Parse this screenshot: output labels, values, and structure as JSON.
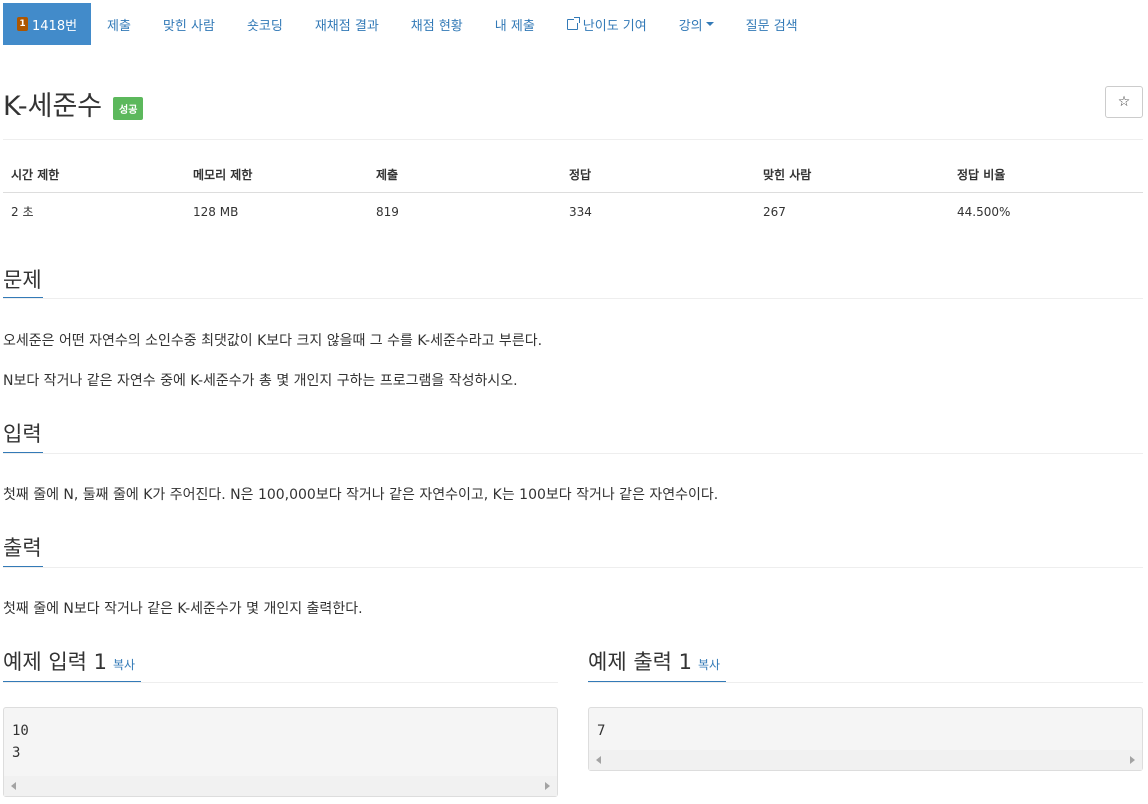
{
  "nav": {
    "problem_tab": "1418번",
    "tier_badge": "1",
    "items": [
      "제출",
      "맞힌 사람",
      "숏코딩",
      "재채점 결과",
      "채점 현황",
      "내 제출",
      "난이도 기여",
      "강의",
      "질문 검색"
    ]
  },
  "problem": {
    "title": "K-세준수",
    "status": "성공",
    "star": "☆"
  },
  "info": {
    "headers": [
      "시간 제한",
      "메모리 제한",
      "제출",
      "정답",
      "맞힌 사람",
      "정답 비율"
    ],
    "values": [
      "2 초",
      "128 MB",
      "819",
      "334",
      "267",
      "44.500%"
    ]
  },
  "sections": {
    "problem_title": "문제",
    "problem_lines": [
      "오세준은 어떤 자연수의 소인수중 최댓값이 K보다 크지 않을때 그 수를 K-세준수라고 부른다.",
      "N보다 작거나 같은 자연수 중에 K-세준수가 총 몇 개인지 구하는 프로그램을 작성하시오."
    ],
    "input_title": "입력",
    "input_text": "첫째 줄에 N, 둘째 줄에 K가 주어진다. N은 100,000보다 작거나 같은 자연수이고, K는 100보다 작거나 같은 자연수이다.",
    "output_title": "출력",
    "output_text": "첫째 줄에 N보다 작거나 같은 K-세준수가 몇 개인지 출력한다."
  },
  "examples": {
    "input_title": "예제 입력 1",
    "output_title": "예제 출력 1",
    "copy_label": "복사",
    "input_lines": [
      "10",
      "3"
    ],
    "output_lines": [
      "7"
    ]
  },
  "colors": {
    "accent": "#337ab7",
    "active_tab": "#428bca",
    "success": "#5cb85c",
    "tier_badge": "#ad5600"
  }
}
